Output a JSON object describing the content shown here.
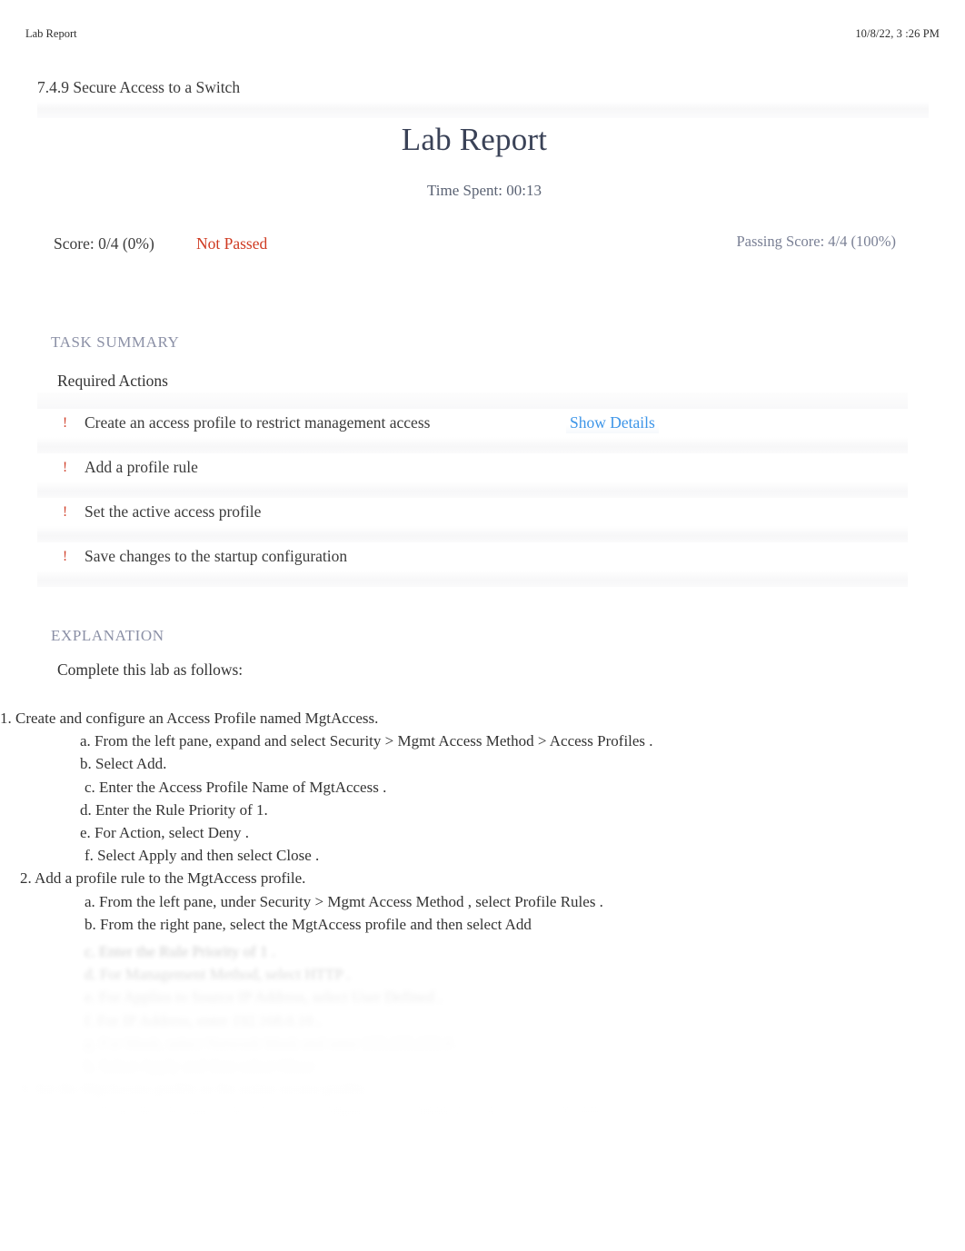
{
  "print_header": {
    "left": "Lab Report",
    "right": "10/8/22, 3  :26 PM"
  },
  "breadcrumb": "7.4.9 Secure Access to a Switch",
  "title": "Lab Report",
  "time_spent": "Time Spent: 00:13",
  "score": {
    "score_text": "Score: 0/4 (0%)",
    "status": "Not Passed",
    "status_color": "#cf3a21",
    "passing_score": "Passing Score: 4/4 (100%)"
  },
  "task_summary": {
    "heading": "TASK SUMMARY",
    "subheading": "Required Actions",
    "marker": "!",
    "marker_color": "#d0402a",
    "show_details_label": "Show Details",
    "link_color": "#3d95e8",
    "items": [
      {
        "label": "Create an access profile to restrict management access",
        "has_details": true
      },
      {
        "label": "Add a profile rule",
        "has_details": false
      },
      {
        "label": "Set the active access profile",
        "has_details": false
      },
      {
        "label": "Save changes to the startup configuration",
        "has_details": false
      }
    ]
  },
  "explanation": {
    "heading": "EXPLANATION",
    "intro": "Complete this lab as follows:",
    "lines": [
      {
        "indent": 0,
        "text": "1. Create and configure an Access Profile named          MgtAccess."
      },
      {
        "indent": 1,
        "text": "a. From the left pane, expand and select          Security  > Mgmt Access Method      > Access Profiles   ."
      },
      {
        "indent": 1,
        "text": "b.  Select   Add."
      },
      {
        "indent": 1,
        "text": "c. Enter the Access Profile Name of        MgtAccess  ."
      },
      {
        "indent": 1,
        "text": "d. Enter the Rule Priority of       1."
      },
      {
        "indent": 1,
        "text": "e. For Action, select     Deny ."
      },
      {
        "indent": 1,
        "text": "f.  Select  Apply  and then select      Close ."
      },
      {
        "indent": 0,
        "text": "2. Add a profile rule to the      MgtAccess profile."
      },
      {
        "indent": 1,
        "text": "a. From the left pane, under       Security   > Mgmt Access Method      , select  Profile Rules   ."
      },
      {
        "indent": 1,
        "text": "b. From the right pane, select the        MgtAccess   profile and then select      Add"
      }
    ],
    "faded_lines": [
      {
        "blur": "fade-a",
        "text": "c. Enter the Rule Priority of    1 ."
      },
      {
        "blur": "fade-a",
        "text": "d. For Management Method, select        HTTP ."
      },
      {
        "blur": "fade-b",
        "text": "e. For  Applies to Source IP Address, select  User Defined ."
      },
      {
        "blur": "fade-b",
        "text": "f. For IP Address, enter     192.168.0.10 ."
      },
      {
        "blur": "fade-c",
        "text": "g. For Mask, select  Network Mask and enter    255.255.255.0 ."
      },
      {
        "blur": "fade-c",
        "text": "h. Select   Apply  and then select      Close ."
      },
      {
        "blur": "fade-d",
        "text": "3. Set the MgtAccess profile as the active access profile."
      },
      {
        "blur": "fade-d",
        "text": "a. From the left pane, select      Security    > Mgmt Access Method      , select  Access Profiles ."
      }
    ]
  }
}
